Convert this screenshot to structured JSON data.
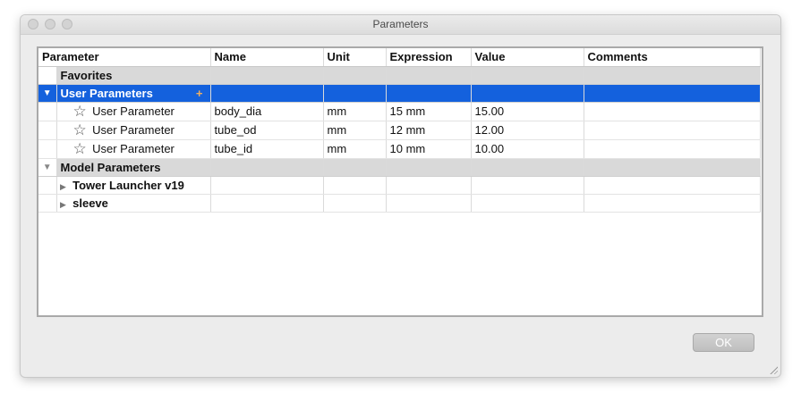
{
  "window": {
    "title": "Parameters"
  },
  "table": {
    "columns": [
      "Parameter",
      "Name",
      "Unit",
      "Expression",
      "Value",
      "Comments"
    ],
    "groups": {
      "favorites": {
        "label": "Favorites"
      },
      "user_parameters": {
        "label": "User Parameters",
        "add_icon": "+",
        "expand_icon": "▼",
        "rows": [
          {
            "parameter": "User Parameter",
            "name": "body_dia",
            "unit": "mm",
            "expression": "15 mm",
            "value": "15.00",
            "comments": ""
          },
          {
            "parameter": "User Parameter",
            "name": "tube_od",
            "unit": "mm",
            "expression": "12 mm",
            "value": "12.00",
            "comments": ""
          },
          {
            "parameter": "User Parameter",
            "name": "tube_id",
            "unit": "mm",
            "expression": "10 mm",
            "value": "10.00",
            "comments": ""
          }
        ]
      },
      "model_parameters": {
        "label": "Model Parameters",
        "expand_icon": "▼",
        "items": [
          {
            "label": "Tower Launcher v19",
            "icon": "▶"
          },
          {
            "label": "sleeve",
            "icon": "▶"
          }
        ]
      }
    },
    "star_icon": "☆"
  },
  "buttons": {
    "ok": "OK"
  }
}
